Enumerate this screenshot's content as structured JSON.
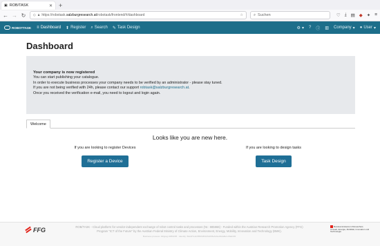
{
  "browser": {
    "tab_title": "ROB/TASK",
    "url_prefix": "https://robotask.",
    "url_domain": "salzburgresearch.at",
    "url_suffix": "/robotask/frontend/#/dashboard",
    "search_placeholder": "Suchen"
  },
  "nav": {
    "logo": "ROBOTTASK",
    "items": [
      {
        "label": "Dashboard",
        "icon": "≡"
      },
      {
        "label": "Register",
        "icon": "⬆"
      },
      {
        "label": "Search",
        "icon": "⌕"
      },
      {
        "label": "Task Design",
        "icon": "✎"
      }
    ],
    "company": "Company",
    "user": "User"
  },
  "page": {
    "title": "Dashboard",
    "alert": {
      "heading": "Your company is now registered",
      "line1": "You can start publishing your catalogue.",
      "line2": "In order to execute business processes your company needs to be verified by an administrator - please stay tuned.",
      "line3": "If you are not being verified with 24h, please contact our support ",
      "email": "robtask@salzburgresearch.at",
      "line3_end": ".",
      "line4": "Once you received the verification e-mail, you need to logout and login again."
    },
    "tab": "Welcome",
    "welcome_heading": "Looks like you are new here.",
    "left_text": "If you are looking to register Devices",
    "left_button": "Register a Device",
    "right_text": "If you are looking to design tasks",
    "right_button": "Task Design"
  },
  "footer": {
    "logo": "FFG",
    "text": "ROB/TASK - Cloud platform for vendor-independent exchange of robot control tasks and processes (Nr.: 885866) - Funded within the Austrian Research Promotion Agency (FFG) Program \"ICT of the Future\" by the Austrian Federal Ministry of Climate Action, Environment, Energy, Mobility, Innovation and Technology (BMK).",
    "small": "Business process: 4digreg-0053205 · Identity: 8debf7ebc6f52f43f4d7a6b5e6d1e4b2a8e4-93ab4f4",
    "ministry": "Bundesministerium Klimaschutz, Umwelt, Energie, Mobilität, Innovation und Technologie"
  }
}
